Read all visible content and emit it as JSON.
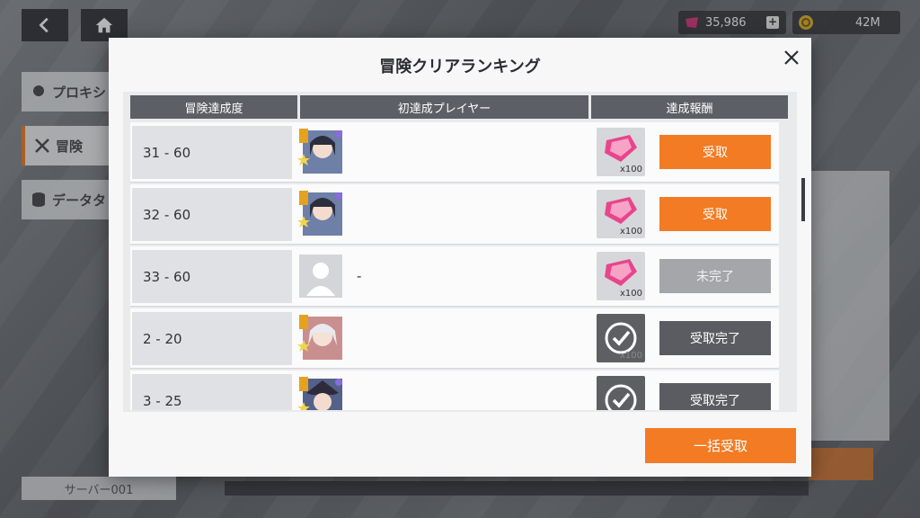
{
  "background": {
    "currency_gem": "35,986",
    "currency_gold": "42M",
    "side_tabs": [
      "プロキシ",
      "冒険",
      "データタ"
    ],
    "server": "サーバー001"
  },
  "modal": {
    "title": "冒険クリアランキング",
    "headers": [
      "冒険達成度",
      "初達成プレイヤー",
      "達成報酬"
    ],
    "rows": [
      {
        "range": "31 - 60",
        "player": "",
        "qty": "x100",
        "button": "受取"
      },
      {
        "range": "32 - 60",
        "player": "",
        "qty": "x100",
        "button": "受取"
      },
      {
        "range": "33 - 60",
        "player": "-",
        "qty": "x100",
        "button": "未完了"
      },
      {
        "range": "2 - 20",
        "player": "",
        "qty": "x100",
        "button": "受取完了"
      },
      {
        "range": "3 - 25",
        "player": "",
        "qty": "",
        "button": "受取完了"
      }
    ],
    "bulk_button": "一括受取"
  },
  "colors": {
    "accent": "#f27b23",
    "header": "#5c5f65",
    "disabled": "#a4a6aa",
    "completed": "#5a5c61"
  }
}
